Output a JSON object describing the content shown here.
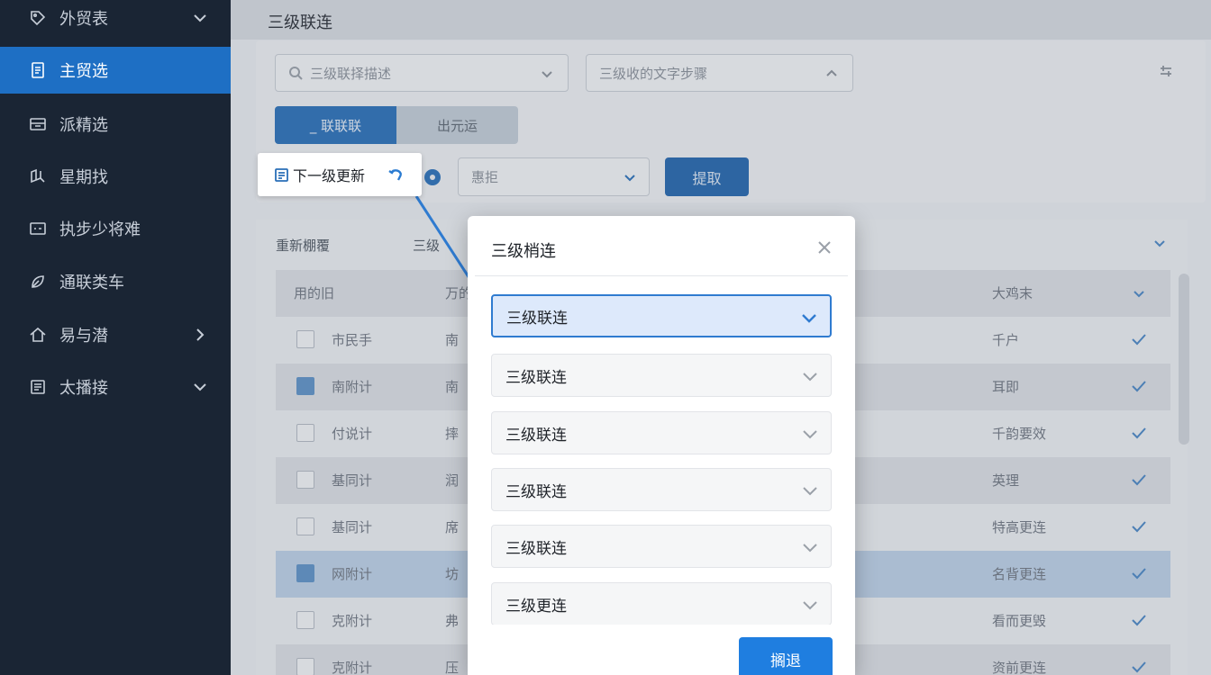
{
  "sidebar": {
    "items": [
      {
        "label": "外贸表",
        "icon": "tag-icon",
        "arrow": "down"
      },
      {
        "label": "主贸选",
        "icon": "document-icon",
        "active": true
      },
      {
        "label": "派精选",
        "icon": "box-icon"
      },
      {
        "label": "星期找",
        "icon": "book-icon"
      },
      {
        "label": "执步少将难",
        "icon": "screen-icon"
      },
      {
        "label": "通联类车",
        "icon": "leaf-icon"
      },
      {
        "label": "易与潜",
        "icon": "home-icon",
        "arrow": "right"
      },
      {
        "label": "太播接",
        "icon": "list-icon",
        "arrow": "down"
      }
    ]
  },
  "header": {
    "title": "三级联连"
  },
  "filters": {
    "search_placeholder": "三级联择描述",
    "second_select": "三级收的文字步骤"
  },
  "tabs": [
    {
      "label": "_ 联联联",
      "active": true
    },
    {
      "label": "出元运"
    }
  ],
  "filter_bar": {
    "select_value": "惠拒",
    "query_label": "提取"
  },
  "tooltip": {
    "text": "下一级更新"
  },
  "table": {
    "section_title": "重新棚覆",
    "section_title2": "三级",
    "headers": [
      "用的旧",
      "万的",
      "大鸡末"
    ],
    "rows": [
      {
        "c1": "市民手",
        "c2": "南",
        "c3": "千户",
        "checked": false,
        "alt": false
      },
      {
        "c1": "南附计",
        "c2": "南",
        "c3": "耳即",
        "checked": true,
        "alt": true
      },
      {
        "c1": "付说计",
        "c2": "摔",
        "c3": "千韵要效",
        "checked": false,
        "alt": false
      },
      {
        "c1": "基同计",
        "c2": "润",
        "c3": "英理",
        "checked": false,
        "alt": true
      },
      {
        "c1": "基同计",
        "c2": "席",
        "c3": "特高更连",
        "checked": false,
        "alt": false
      },
      {
        "c1": "网附计",
        "c2": "坊",
        "c3": "名背更连",
        "checked": false,
        "hl": true
      },
      {
        "c1": "克附计",
        "c2": "弗",
        "c3": "看而更毁",
        "checked": false,
        "alt": false
      },
      {
        "c1": "克附计",
        "c2": "压",
        "c3": "资前更连",
        "checked": false,
        "alt": true
      }
    ]
  },
  "dialog": {
    "title": "三级梢连",
    "dropdowns": [
      "三级联连",
      "三级联连",
      "三级联连",
      "三级联连",
      "三级联连",
      "三级更连"
    ],
    "confirm_label": "搁退"
  },
  "colors": {
    "sidebar_bg": "#1a2534",
    "sidebar_active": "#1e6fc4",
    "primary": "#1f7ee0",
    "selected_dropdown_bg": "#dde9fb"
  }
}
